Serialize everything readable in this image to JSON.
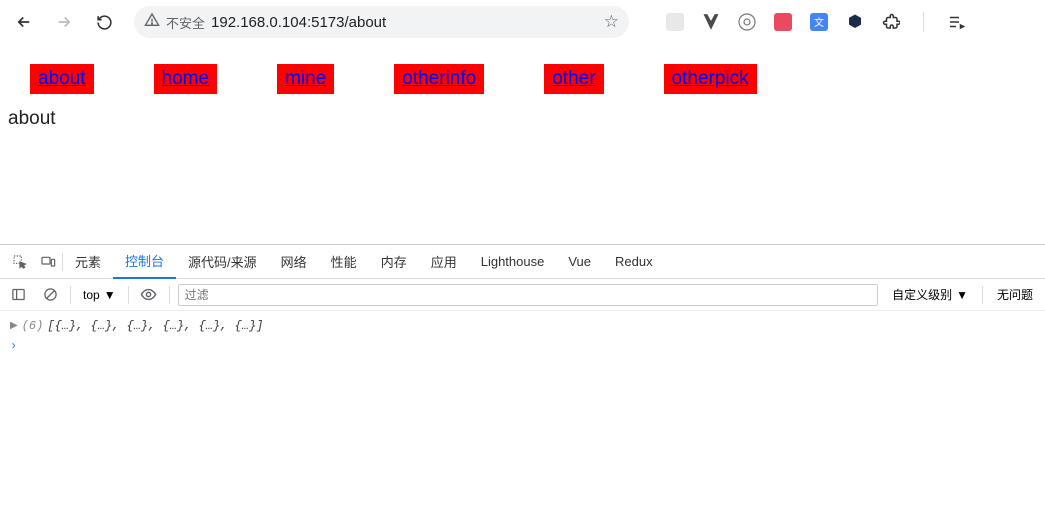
{
  "browser": {
    "insecure_label": "不安全",
    "url": "192.168.0.104:5173/about"
  },
  "nav": {
    "items": [
      {
        "label": "about"
      },
      {
        "label": "home"
      },
      {
        "label": "mine"
      },
      {
        "label": "otherinfo"
      },
      {
        "label": "other"
      },
      {
        "label": "otherpick"
      }
    ]
  },
  "page": {
    "title": "about"
  },
  "devtools": {
    "tabs": {
      "elements": "元素",
      "console": "控制台",
      "sources": "源代码/来源",
      "network": "网络",
      "performance": "性能",
      "memory": "内存",
      "application": "应用",
      "lighthouse": "Lighthouse",
      "vue": "Vue",
      "redux": "Redux"
    },
    "console_toolbar": {
      "context": "top",
      "filter_placeholder": "过滤",
      "levels": "自定义级别",
      "issues": "无问题"
    },
    "console_out": {
      "count": "(6)",
      "preview": "[{…}, {…}, {…}, {…}, {…}, {…}]"
    }
  }
}
